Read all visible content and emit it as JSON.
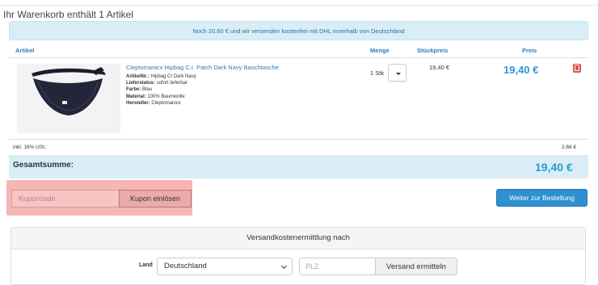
{
  "cart": {
    "heading": "Ihr Warenkorb enthält 1 Artikel",
    "shipping_notice": "Noch 20,60 € und wir versenden kostenfrei mit DHL innerhalb von Deutschland"
  },
  "table": {
    "headers": {
      "article": "Artikel",
      "quantity": "Menge",
      "unit_price": "Stückpreis",
      "price": "Preis"
    }
  },
  "item": {
    "name": "Cleptomanicx Hipbag C.I. Patch Dark Navy Bauchtasche",
    "attributes": [
      {
        "label": "ArtikelNr.:",
        "value": "Hipbag CI Dark Navy"
      },
      {
        "label": "Lieferstatus:",
        "value": "sofort lieferbar"
      },
      {
        "label": "Farbe:",
        "value": "Blau"
      },
      {
        "label": "Material:",
        "value": "100% Baumwolle"
      },
      {
        "label": "Hersteller:",
        "value": "Cleptomanicx"
      }
    ],
    "quantity": "1 Stk",
    "unit_price": "19,40 €",
    "price": "19,40 €",
    "image_icon": "fanny-pack-image",
    "delete_icon": "trash-icon"
  },
  "totals": {
    "vat_label": "inkl. 16% USt.:",
    "vat_value": "2,68 €",
    "total_label": "Gesamtsumme:",
    "total_value": "19,40 €"
  },
  "coupon": {
    "placeholder": "Kuponcode",
    "button": "Kupon einlösen"
  },
  "checkout": {
    "button": "Weiter zur Bestellung"
  },
  "shipping_calc": {
    "title": "Versandkostenermittlung nach",
    "country_label": "Land",
    "country_value": "Deutschland",
    "zip_placeholder": "PLZ",
    "button": "Versand ermitteln"
  },
  "colors": {
    "accent": "#337ab7",
    "price": "#2b9bd3",
    "info_bg": "#d9edf7",
    "danger": "#d9534f",
    "highlight": "#f4a9a9"
  }
}
